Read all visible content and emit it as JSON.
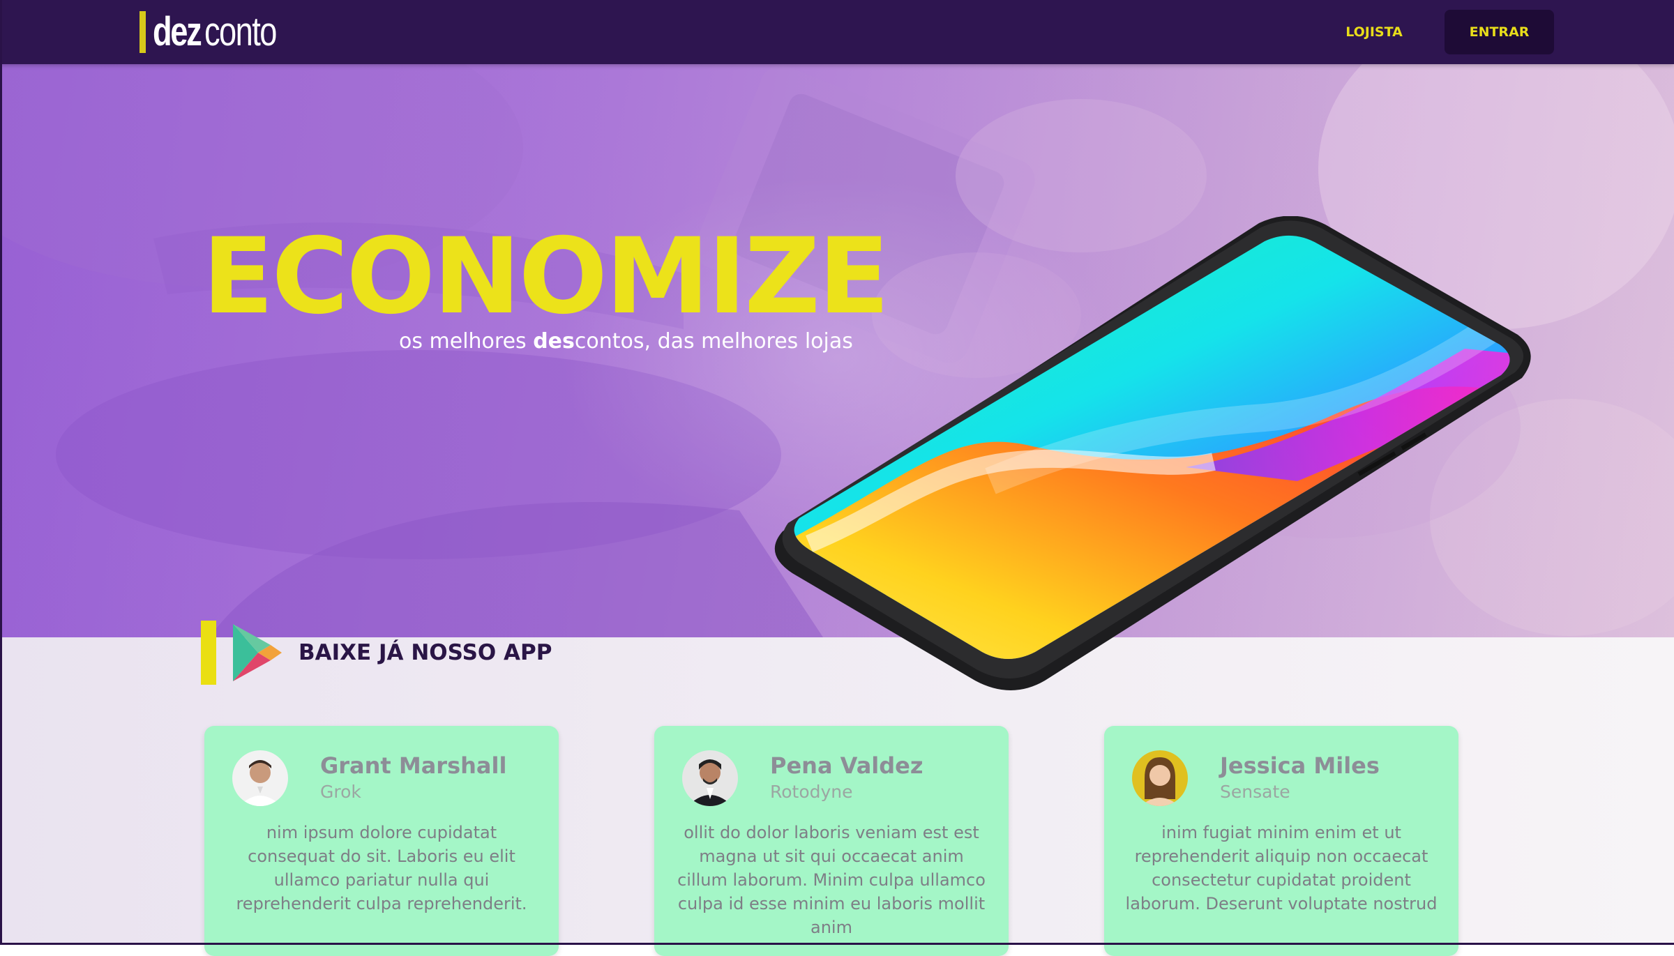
{
  "brand": {
    "logo_prefix": "dez",
    "logo_suffix": "conto",
    "logo_accent_color": "#d7c91a"
  },
  "nav": {
    "lojista_label": "LOJISTA",
    "entrar_label": "ENTRAR"
  },
  "hero": {
    "title": "ECONOMIZE",
    "subtitle_before": "os melhores ",
    "subtitle_bold": "des",
    "subtitle_after": "contos, das melhores lojas",
    "title_color": "#ece21a"
  },
  "app_cta": {
    "label": "BAIXE JÁ NOSSO APP",
    "icon": "google-play-icon"
  },
  "testimonials": [
    {
      "name": "Grant Marshall",
      "company": "Grok",
      "text": "nim ipsum dolore cupidatat consequat do sit. Laboris eu elit ullamco pariatur nulla qui reprehenderit culpa reprehenderit."
    },
    {
      "name": "Pena Valdez",
      "company": "Rotodyne",
      "text": "ollit do dolor laboris veniam est est magna ut sit qui occaecat anim cillum laborum. Minim culpa ullamco culpa id esse minim eu laboris mollit anim"
    },
    {
      "name": "Jessica Miles",
      "company": "Sensate",
      "text": "inim fugiat minim enim et ut reprehenderit aliquip non occaecat consectetur cupidatat proident laborum. Deserunt voluptate nostrud"
    }
  ],
  "colors": {
    "navbar": "#2e1550",
    "card_background": "#a4f6c7",
    "accent_yellow": "#eadf12"
  }
}
